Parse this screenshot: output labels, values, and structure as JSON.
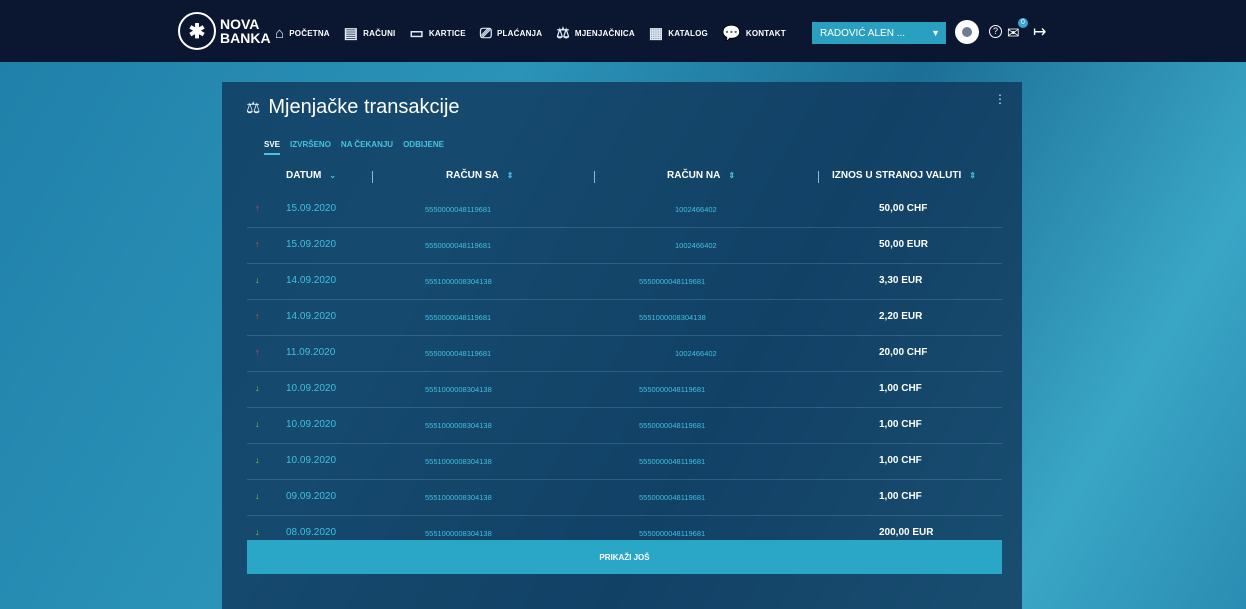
{
  "brand": {
    "line1": "NOVA",
    "line2": "BANKA"
  },
  "nav": [
    {
      "label": "POČETNA",
      "icon": "home-icon",
      "glyph": "⌂"
    },
    {
      "label": "RAČUNI",
      "icon": "accounts-icon",
      "glyph": "▤"
    },
    {
      "label": "KARTICE",
      "icon": "card-icon",
      "glyph": "▭"
    },
    {
      "label": "PLAĆANJA",
      "icon": "payment-icon",
      "glyph": "⎚"
    },
    {
      "label": "MJENJAČNICA",
      "icon": "exchange-icon",
      "glyph": "⚖"
    },
    {
      "label": "KATALOG",
      "icon": "catalog-icon",
      "glyph": "▦"
    },
    {
      "label": "KONTAKT",
      "icon": "chat-icon",
      "glyph": "💬"
    }
  ],
  "user": {
    "name": "RADOVIĆ ALEN ..."
  },
  "header_icons": {
    "help": "?",
    "message_count": "0",
    "logout": "↦"
  },
  "panel": {
    "title": "Mjenjačke transakcije",
    "menu": "⋮",
    "tabs": [
      "SVE",
      "IZVRŠENO",
      "NA ČEKANJU",
      "ODBIJENE"
    ],
    "columns": [
      "DATUM",
      "RAČUN SA",
      "RAČUN NA",
      "IZNOS U STRANOJ VALUTI"
    ],
    "rows": [
      {
        "dir": "up",
        "date": "15.09.2020",
        "from": "5550000048119681",
        "to": "1002466402",
        "amount": "50,00 CHF"
      },
      {
        "dir": "up",
        "date": "15.09.2020",
        "from": "5550000048119681",
        "to": "1002466402",
        "amount": "50,00 EUR"
      },
      {
        "dir": "down",
        "date": "14.09.2020",
        "from": "5551000008304138",
        "to": "5550000048119681",
        "amount": "3,30 EUR"
      },
      {
        "dir": "up",
        "date": "14.09.2020",
        "from": "5550000048119681",
        "to": "5551000008304138",
        "amount": "2,20 EUR"
      },
      {
        "dir": "up",
        "date": "11.09.2020",
        "from": "5550000048119681",
        "to": "1002466402",
        "amount": "20,00 CHF"
      },
      {
        "dir": "down",
        "date": "10.09.2020",
        "from": "5551000008304138",
        "to": "5550000048119681",
        "amount": "1,00 CHF"
      },
      {
        "dir": "down",
        "date": "10.09.2020",
        "from": "5551000008304138",
        "to": "5550000048119681",
        "amount": "1,00 CHF"
      },
      {
        "dir": "down",
        "date": "10.09.2020",
        "from": "5551000008304138",
        "to": "5550000048119681",
        "amount": "1,00 CHF"
      },
      {
        "dir": "down",
        "date": "09.09.2020",
        "from": "5551000008304138",
        "to": "5550000048119681",
        "amount": "1,00 CHF"
      },
      {
        "dir": "down",
        "date": "08.09.2020",
        "from": "5551000008304138",
        "to": "5550000048119681",
        "amount": "200,00 EUR"
      }
    ],
    "more_label": "PRIKAŽI JOŠ"
  }
}
